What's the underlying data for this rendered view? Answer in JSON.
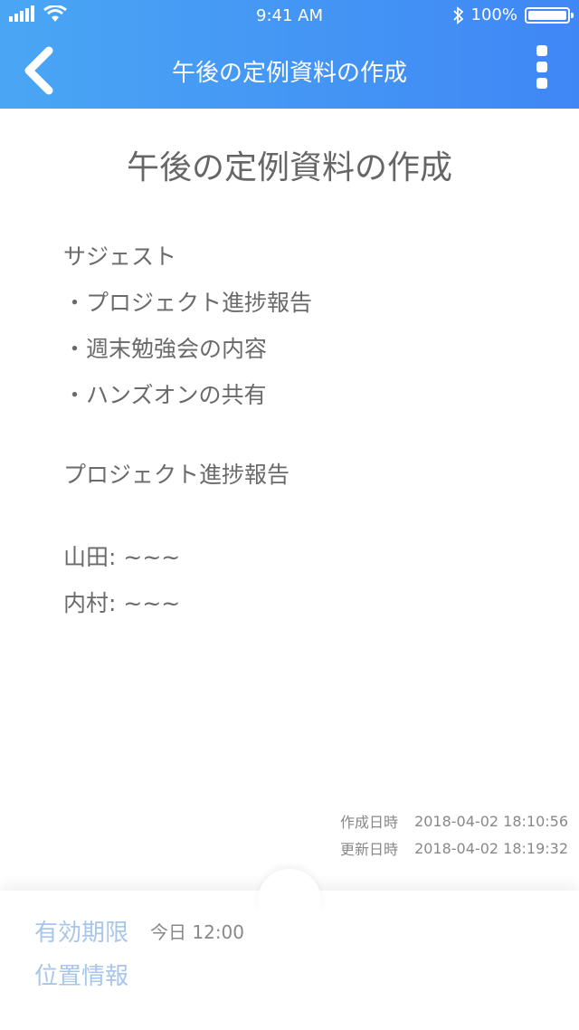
{
  "status": {
    "time": "9:41 AM",
    "battery": "100%"
  },
  "nav": {
    "title": "午後の定例資料の作成"
  },
  "doc": {
    "title": "午後の定例資料の作成",
    "suggest_heading": "サジェスト",
    "suggestions": [
      "・プロジェクト進捗報告",
      "・週末勉強会の内容",
      "・ハンズオンの共有"
    ],
    "section_heading": "プロジェクト進捗報告",
    "entries": [
      "山田: ~~~",
      "内村: ~~~"
    ]
  },
  "meta": {
    "created_label": "作成日時",
    "created_value": "2018-04-02 18:10:56",
    "updated_label": "更新日時",
    "updated_value": "2018-04-02 18:19:32"
  },
  "bottom": {
    "expiry_label": "有効期限",
    "expiry_value": "今日 12:00",
    "location_label": "位置情報"
  },
  "colors": {
    "header_start": "#4aa6f4",
    "header_end": "#3f87f5",
    "accent_light": "#a7c6ea"
  }
}
